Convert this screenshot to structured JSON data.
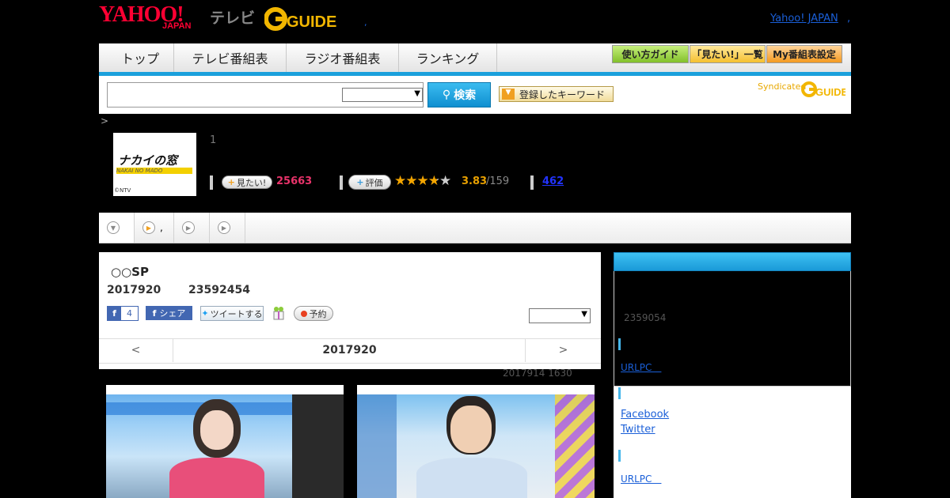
{
  "header": {
    "yahoo_logo": "YAHOO!",
    "yahoo_japan": "JAPAN",
    "tv_label": "テレビ",
    "gguide_logo": "G-GUIDE",
    "yahoo_japan_link": "Yahoo! JAPAN",
    "separator": ",",
    "dot": ","
  },
  "nav": {
    "tabs": [
      "トップ",
      "テレビ番組表",
      "ラジオ番組表",
      "ランキング"
    ],
    "buttons": [
      "使い方ガイド",
      "「見たい!」一覧",
      "My番組表設定"
    ]
  },
  "search": {
    "input_value": "",
    "select_value": "",
    "search_label": "検索",
    "keyword_label": "登録したキーワード",
    "syndicated_label": "Syndicated"
  },
  "program": {
    "breadcrumb": ">",
    "thumb_title": "ナカイの窓",
    "thumb_sub": "NAKAI NO MADO",
    "thumb_copyright": "©NTV",
    "meta_number": "1",
    "mitai_label": "見たい!",
    "mitai_count": "25663",
    "hyoka_label": "評価",
    "rating": "3.83",
    "rating_count": "/159",
    "review_count": "462",
    "stars_fraction": 0.766
  },
  "subtabs": [
    {
      "label": ""
    },
    {
      "label": ","
    },
    {
      "label": ""
    },
    {
      "label": ""
    }
  ],
  "episode": {
    "title": "○○SP",
    "date": "2017920",
    "id": "23592454",
    "fb_like_count": "4",
    "fb_share_label": "シェア",
    "tweet_label": "ツイートする",
    "yoyaku_label": "予約",
    "select_value": "",
    "nav_prev": "<",
    "nav_date": "2017920",
    "nav_next": ">",
    "updated": "2017914  1630"
  },
  "side": {
    "number": "2359054",
    "links": [
      "URLPC　",
      "Facebook",
      "Twitter",
      "URLPC　"
    ]
  },
  "colors": {
    "accent_blue": "#1aa0dc",
    "mitai_pink": "#e8336a",
    "rating_orange": "#e8a000",
    "facebook_blue": "#4267b2"
  }
}
